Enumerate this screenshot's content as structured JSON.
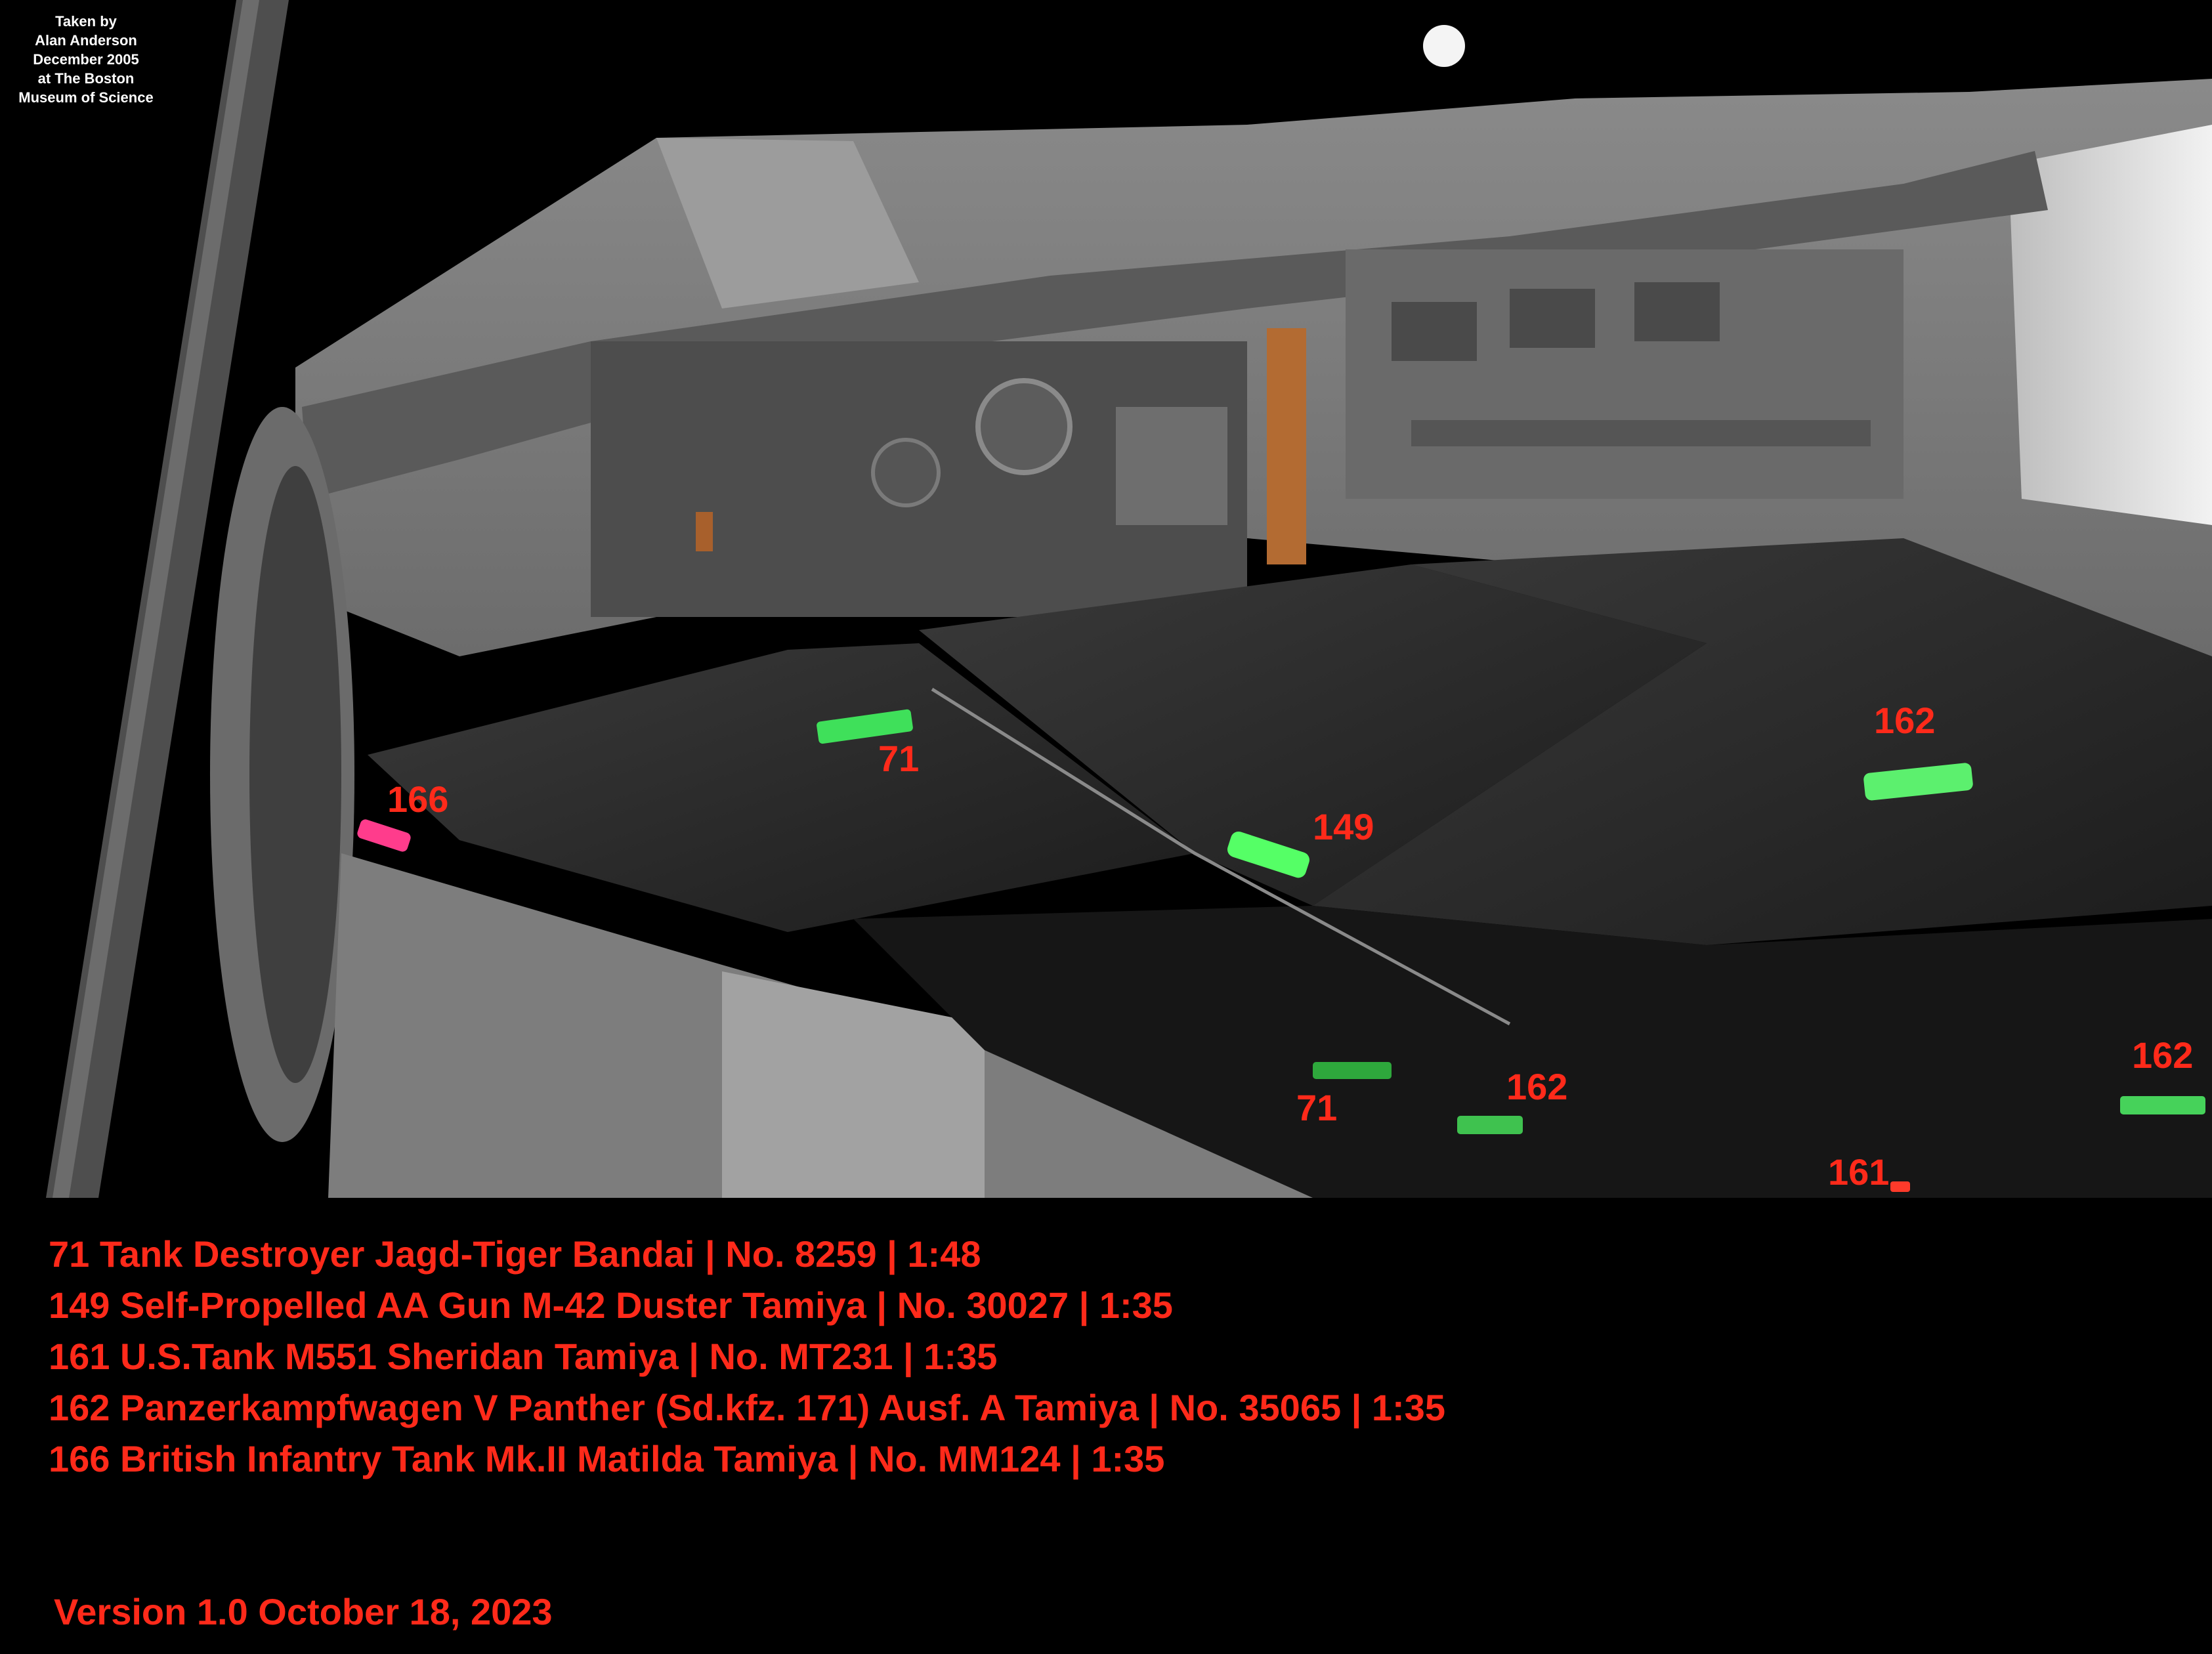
{
  "credit": [
    "Taken by",
    "Alan Anderson",
    "December 2005",
    "at The Boston",
    "Museum of Science"
  ],
  "callouts": [
    "166",
    "71",
    "149",
    "162",
    "71",
    "162",
    "162",
    "161"
  ],
  "legend": [
    "71 Tank Destroyer Jagd-Tiger Bandai | No. 8259 | 1:48",
    "149 Self-Propelled AA Gun M-42 Duster Tamiya | No. 30027 | 1:35",
    "161 U.S.Tank M551 Sheridan Tamiya | No. MT231 | 1:35",
    "162 Panzerkampfwagen V Panther (Sd.kfz. 171) Ausf. A Tamiya | No. 35065 | 1:35",
    "166 British Infantry Tank Mk.II Matilda Tamiya | No. MM124 | 1:35"
  ],
  "version": "Version 1.0 October 18, 2023",
  "colors": {
    "label_red": "#ff2a1a",
    "highlight_green": "#3fe05a",
    "highlight_pink": "#ff3c8c",
    "background": "#000000"
  }
}
